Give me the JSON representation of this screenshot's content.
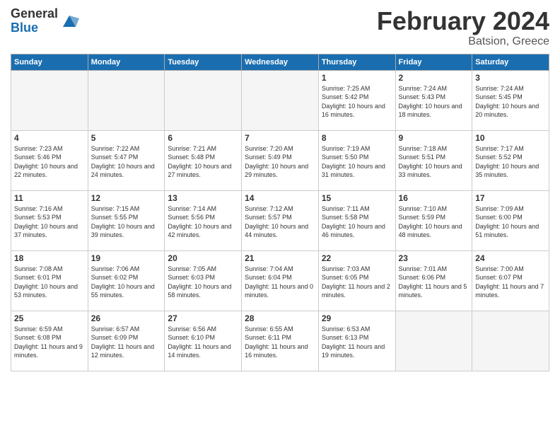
{
  "header": {
    "logo_general": "General",
    "logo_blue": "Blue",
    "month_title": "February 2024",
    "location": "Batsion, Greece"
  },
  "weekdays": [
    "Sunday",
    "Monday",
    "Tuesday",
    "Wednesday",
    "Thursday",
    "Friday",
    "Saturday"
  ],
  "weeks": [
    [
      {
        "num": "",
        "empty": true
      },
      {
        "num": "",
        "empty": true
      },
      {
        "num": "",
        "empty": true
      },
      {
        "num": "",
        "empty": true
      },
      {
        "num": "1",
        "sunrise": "7:25 AM",
        "sunset": "5:42 PM",
        "daylight": "10 hours and 16 minutes."
      },
      {
        "num": "2",
        "sunrise": "7:24 AM",
        "sunset": "5:43 PM",
        "daylight": "10 hours and 18 minutes."
      },
      {
        "num": "3",
        "sunrise": "7:24 AM",
        "sunset": "5:45 PM",
        "daylight": "10 hours and 20 minutes."
      }
    ],
    [
      {
        "num": "4",
        "sunrise": "7:23 AM",
        "sunset": "5:46 PM",
        "daylight": "10 hours and 22 minutes."
      },
      {
        "num": "5",
        "sunrise": "7:22 AM",
        "sunset": "5:47 PM",
        "daylight": "10 hours and 24 minutes."
      },
      {
        "num": "6",
        "sunrise": "7:21 AM",
        "sunset": "5:48 PM",
        "daylight": "10 hours and 27 minutes."
      },
      {
        "num": "7",
        "sunrise": "7:20 AM",
        "sunset": "5:49 PM",
        "daylight": "10 hours and 29 minutes."
      },
      {
        "num": "8",
        "sunrise": "7:19 AM",
        "sunset": "5:50 PM",
        "daylight": "10 hours and 31 minutes."
      },
      {
        "num": "9",
        "sunrise": "7:18 AM",
        "sunset": "5:51 PM",
        "daylight": "10 hours and 33 minutes."
      },
      {
        "num": "10",
        "sunrise": "7:17 AM",
        "sunset": "5:52 PM",
        "daylight": "10 hours and 35 minutes."
      }
    ],
    [
      {
        "num": "11",
        "sunrise": "7:16 AM",
        "sunset": "5:53 PM",
        "daylight": "10 hours and 37 minutes."
      },
      {
        "num": "12",
        "sunrise": "7:15 AM",
        "sunset": "5:55 PM",
        "daylight": "10 hours and 39 minutes."
      },
      {
        "num": "13",
        "sunrise": "7:14 AM",
        "sunset": "5:56 PM",
        "daylight": "10 hours and 42 minutes."
      },
      {
        "num": "14",
        "sunrise": "7:12 AM",
        "sunset": "5:57 PM",
        "daylight": "10 hours and 44 minutes."
      },
      {
        "num": "15",
        "sunrise": "7:11 AM",
        "sunset": "5:58 PM",
        "daylight": "10 hours and 46 minutes."
      },
      {
        "num": "16",
        "sunrise": "7:10 AM",
        "sunset": "5:59 PM",
        "daylight": "10 hours and 48 minutes."
      },
      {
        "num": "17",
        "sunrise": "7:09 AM",
        "sunset": "6:00 PM",
        "daylight": "10 hours and 51 minutes."
      }
    ],
    [
      {
        "num": "18",
        "sunrise": "7:08 AM",
        "sunset": "6:01 PM",
        "daylight": "10 hours and 53 minutes."
      },
      {
        "num": "19",
        "sunrise": "7:06 AM",
        "sunset": "6:02 PM",
        "daylight": "10 hours and 55 minutes."
      },
      {
        "num": "20",
        "sunrise": "7:05 AM",
        "sunset": "6:03 PM",
        "daylight": "10 hours and 58 minutes."
      },
      {
        "num": "21",
        "sunrise": "7:04 AM",
        "sunset": "6:04 PM",
        "daylight": "11 hours and 0 minutes."
      },
      {
        "num": "22",
        "sunrise": "7:03 AM",
        "sunset": "6:05 PM",
        "daylight": "11 hours and 2 minutes."
      },
      {
        "num": "23",
        "sunrise": "7:01 AM",
        "sunset": "6:06 PM",
        "daylight": "11 hours and 5 minutes."
      },
      {
        "num": "24",
        "sunrise": "7:00 AM",
        "sunset": "6:07 PM",
        "daylight": "11 hours and 7 minutes."
      }
    ],
    [
      {
        "num": "25",
        "sunrise": "6:59 AM",
        "sunset": "6:08 PM",
        "daylight": "11 hours and 9 minutes."
      },
      {
        "num": "26",
        "sunrise": "6:57 AM",
        "sunset": "6:09 PM",
        "daylight": "11 hours and 12 minutes."
      },
      {
        "num": "27",
        "sunrise": "6:56 AM",
        "sunset": "6:10 PM",
        "daylight": "11 hours and 14 minutes."
      },
      {
        "num": "28",
        "sunrise": "6:55 AM",
        "sunset": "6:11 PM",
        "daylight": "11 hours and 16 minutes."
      },
      {
        "num": "29",
        "sunrise": "6:53 AM",
        "sunset": "6:13 PM",
        "daylight": "11 hours and 19 minutes."
      },
      {
        "num": "",
        "empty": true
      },
      {
        "num": "",
        "empty": true
      }
    ]
  ]
}
